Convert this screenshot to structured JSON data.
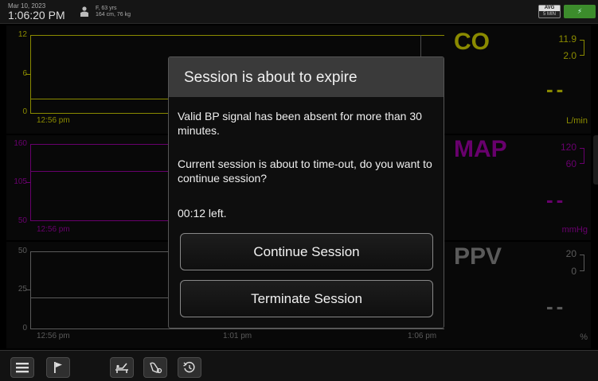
{
  "header": {
    "date": "Mar 10, 2023",
    "time": "1:06:20 PM",
    "patient_line1": "F, 63 yrs",
    "patient_line2": "164 cm, 76 kg",
    "avg_label": "AVG",
    "avg_interval": "5 MIN"
  },
  "panels": [
    {
      "name": "CO",
      "color": "#d4d400",
      "y_ticks": [
        "12",
        "6",
        "0"
      ],
      "time_label": "12:56 pm",
      "upper_limit": "11.9",
      "lower_limit": "2.0",
      "value": "--",
      "unit": "L/min"
    },
    {
      "name": "MAP",
      "color": "#a000a8",
      "y_ticks": [
        "160",
        "105",
        "50"
      ],
      "time_label": "12:56 pm",
      "upper_limit": "120",
      "lower_limit": "60",
      "value": "--",
      "unit": "mmHg"
    },
    {
      "name": "PPV",
      "color": "#8a8a8a",
      "y_ticks": [
        "50",
        "25",
        "0"
      ],
      "time_labels": [
        "12:56 pm",
        "1:01 pm",
        "1:06 pm"
      ],
      "upper_limit": "20",
      "lower_limit": "0",
      "value": "--",
      "unit": "%"
    }
  ],
  "dialog": {
    "title": "Session is about to expire",
    "message1": "Valid BP signal has been absent for more than 30 minutes.",
    "message2": "Current session is about to time-out, do you want to continue session?",
    "countdown": "00:12 left.",
    "continue_label": "Continue Session",
    "terminate_label": "Terminate Session"
  },
  "toolbar": {
    "icons": [
      "menu-icon",
      "flag-icon",
      "patient-bed-icon",
      "hand-monitor-icon",
      "history-icon"
    ]
  }
}
